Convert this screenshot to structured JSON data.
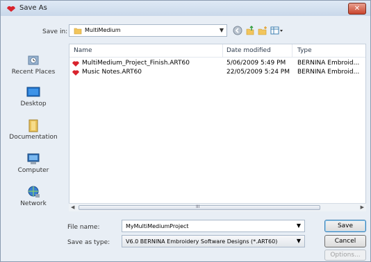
{
  "window": {
    "title": "Save As",
    "close_label": "✕"
  },
  "savein": {
    "label": "Save in:",
    "value": "MultiMedium"
  },
  "places": [
    {
      "label": "Recent Places",
      "icon": "recent-places-icon"
    },
    {
      "label": "Desktop",
      "icon": "desktop-icon"
    },
    {
      "label": "Documentation",
      "icon": "documentation-icon"
    },
    {
      "label": "Computer",
      "icon": "computer-icon"
    },
    {
      "label": "Network",
      "icon": "network-icon"
    }
  ],
  "filelist": {
    "columns": [
      "Name",
      "Date modified",
      "Type"
    ],
    "rows": [
      {
        "name": "MultiMedium_Project_Finish.ART60",
        "date": "5/06/2009 5:49 PM",
        "type": "BERNINA Embroid..."
      },
      {
        "name": "Music Notes.ART60",
        "date": "22/05/2009 5:24 PM",
        "type": "BERNINA Embroid..."
      }
    ]
  },
  "filename": {
    "label": "File name:",
    "value": "MyMultiMediumProject"
  },
  "savetype": {
    "label": "Save as type:",
    "value": "V6.0 BERNINA Embroidery Software Designs (*.ART60)"
  },
  "buttons": {
    "save": "Save",
    "cancel": "Cancel",
    "options": "Options..."
  },
  "scroll": {
    "thumb_label": "III"
  },
  "colors": {
    "accent": "#3c7fb1",
    "title_icon": "#d9232d"
  }
}
